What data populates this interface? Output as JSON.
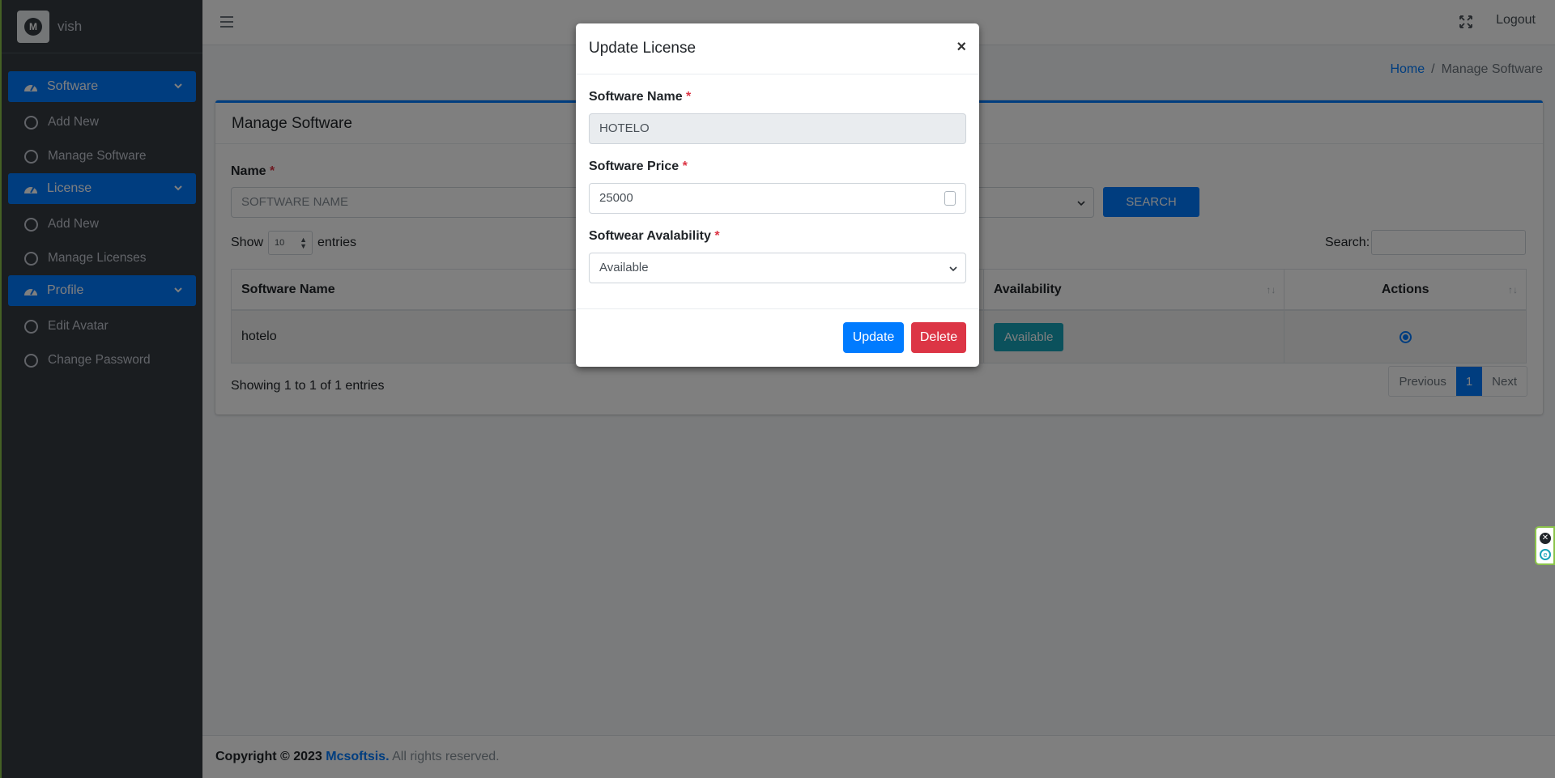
{
  "sidebar": {
    "brand_name": "vish",
    "groups": [
      {
        "label": "Software",
        "items": [
          "Add New",
          "Manage Software"
        ]
      },
      {
        "label": "License",
        "items": [
          "Add New",
          "Manage Licenses"
        ]
      },
      {
        "label": "Profile",
        "items": [
          "Edit Avatar",
          "Change Password"
        ]
      }
    ]
  },
  "topbar": {
    "logout_label": "Logout"
  },
  "breadcrumb": {
    "home": "Home",
    "separator": "/",
    "current": "Manage Software"
  },
  "card": {
    "title": "Manage Software",
    "name_label": "Name",
    "required_mark": "*",
    "name_placeholder": "SOFTWARE NAME",
    "search_button": "SEARCH",
    "show_label": "Show",
    "entries_value": "10",
    "entries_label": "entries",
    "search_label": "Search:",
    "table": {
      "headers": [
        "Software Name",
        "Availability",
        "Actions"
      ],
      "rows": [
        {
          "name": "hotelo",
          "availability": "Available"
        }
      ]
    },
    "showing_text": "Showing 1 to 1 of 1 entries",
    "pagination": {
      "previous": "Previous",
      "current": "1",
      "next": "Next"
    }
  },
  "footer": {
    "copyright": "Copyright © 2023",
    "company": "Mcsoftsis.",
    "rights": "All rights reserved."
  },
  "modal": {
    "title": "Update License",
    "close": "×",
    "fields": {
      "software_name_label": "Software Name",
      "software_name_value": "HOTELO",
      "software_price_label": "Software Price",
      "software_price_value": "25000",
      "availability_label": "Softwear Avalability",
      "availability_value": "Available"
    },
    "update_button": "Update",
    "delete_button": "Delete"
  },
  "colors": {
    "primary": "#007bff",
    "danger": "#dc3545",
    "info": "#17a2b8",
    "sidebar": "#343a40"
  }
}
